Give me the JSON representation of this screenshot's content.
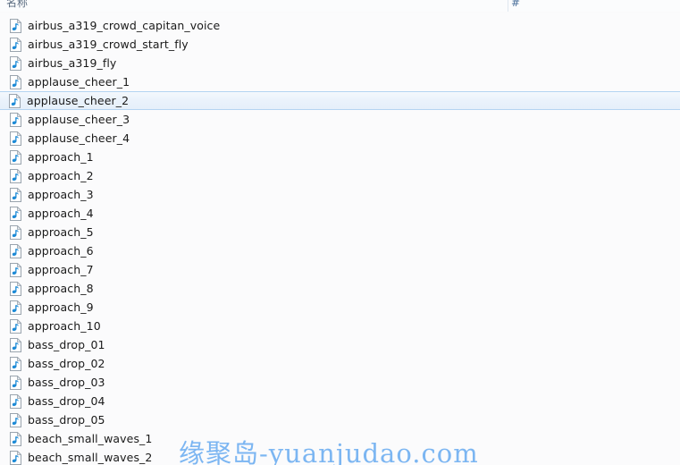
{
  "header": {
    "name_column": "名称",
    "number_column": "#"
  },
  "icons": {
    "file_icon": "music-note-file-icon"
  },
  "colors": {
    "background": "#fbfbfc",
    "header_text": "#5a6b80",
    "row_text": "#1a1a1a",
    "selection_fill": "#eaf2fb",
    "selection_border": "#b4d4f1",
    "icon_note": "#1c8ad6",
    "watermark": "#7cb6f2"
  },
  "watermark": {
    "text": "缘聚岛-yuanjudao.com"
  },
  "files": [
    {
      "name": "airbus_a319_crowd_capitan_voice",
      "selected": false
    },
    {
      "name": "airbus_a319_crowd_start_fly",
      "selected": false
    },
    {
      "name": "airbus_a319_fly",
      "selected": false
    },
    {
      "name": "applause_cheer_1",
      "selected": false
    },
    {
      "name": "applause_cheer_2",
      "selected": true
    },
    {
      "name": "applause_cheer_3",
      "selected": false
    },
    {
      "name": "applause_cheer_4",
      "selected": false
    },
    {
      "name": "approach_1",
      "selected": false
    },
    {
      "name": "approach_2",
      "selected": false
    },
    {
      "name": "approach_3",
      "selected": false
    },
    {
      "name": "approach_4",
      "selected": false
    },
    {
      "name": "approach_5",
      "selected": false
    },
    {
      "name": "approach_6",
      "selected": false
    },
    {
      "name": "approach_7",
      "selected": false
    },
    {
      "name": "approach_8",
      "selected": false
    },
    {
      "name": "approach_9",
      "selected": false
    },
    {
      "name": "approach_10",
      "selected": false
    },
    {
      "name": "bass_drop_01",
      "selected": false
    },
    {
      "name": "bass_drop_02",
      "selected": false
    },
    {
      "name": "bass_drop_03",
      "selected": false
    },
    {
      "name": "bass_drop_04",
      "selected": false
    },
    {
      "name": "bass_drop_05",
      "selected": false
    },
    {
      "name": "beach_small_waves_1",
      "selected": false
    },
    {
      "name": "beach_small_waves_2",
      "selected": false
    }
  ]
}
